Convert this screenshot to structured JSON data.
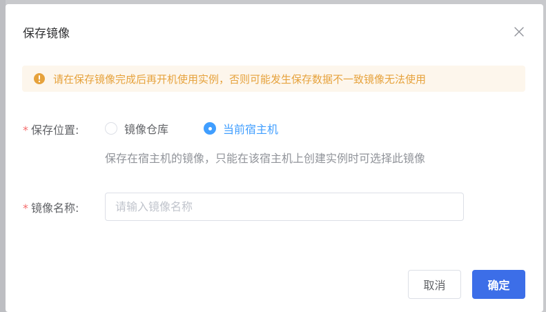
{
  "dialog": {
    "title": "保存镜像",
    "alert_text": "请在保存镜像完成后再开机使用实例，否则可能发生保存数据不一致镜像无法使用",
    "colors": {
      "warning": "#e6a23c",
      "warning_bg": "#fdf6ec",
      "primary": "#3c6ee8",
      "required": "#f56c6c"
    }
  },
  "form": {
    "location": {
      "required_mark": "*",
      "label": "保存位置:",
      "options": [
        {
          "label": "镜像仓库",
          "checked": false
        },
        {
          "label": "当前宿主机",
          "checked": true
        }
      ],
      "hint": "保存在宿主机的镜像，只能在该宿主机上创建实例时可选择此镜像"
    },
    "name": {
      "required_mark": "*",
      "label": "镜像名称:",
      "value": "",
      "placeholder": "请输入镜像名称"
    }
  },
  "footer": {
    "cancel_label": "取消",
    "confirm_label": "确定"
  }
}
